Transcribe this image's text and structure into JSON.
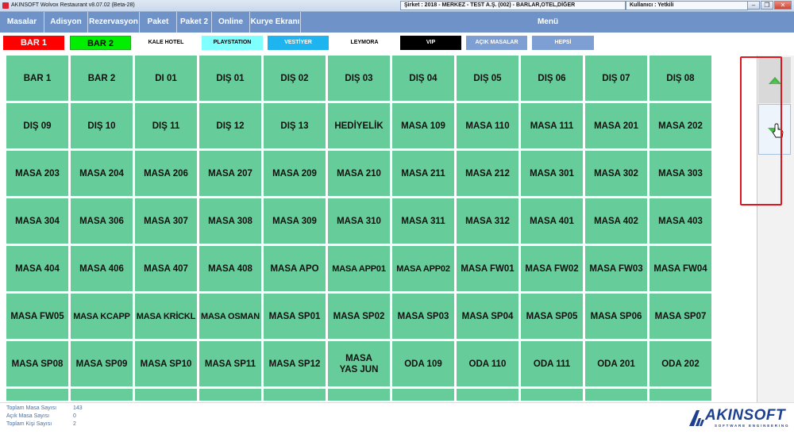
{
  "window": {
    "title": "AKINSOFT Wolvox Restaurant v8.07.02 (Beta-28)",
    "company": "Şirket : 2018 - MERKEZ - TEST A.Ş. (002) - BARLAR,OTEL,DİĞER",
    "user": "Kullanıcı : Yetkili",
    "buttons": {
      "minimize": "‒",
      "maximize": "▭",
      "restore": "❐",
      "close": "✕"
    }
  },
  "menu": {
    "items": [
      "Masalar",
      "Adisyon",
      "Rezervasyon",
      "Paket",
      "Paket 2",
      "Online",
      "Kurye Ekranı"
    ],
    "title": "Menü",
    "color": "#6f93c9"
  },
  "filters": [
    {
      "label": "BAR 1",
      "bg": "#ff0000",
      "fg": "#ffffff"
    },
    {
      "label": "BAR 2",
      "bg": "#00ee00",
      "fg": "#000000"
    },
    {
      "label": "KALE HOTEL",
      "bg": "#ffffff",
      "fg": "#000000"
    },
    {
      "label": "PLAYSTATION",
      "bg": "#80ffff",
      "fg": "#000000"
    },
    {
      "label": "VESTİYER",
      "bg": "#1eb4f0",
      "fg": "#ffffff"
    },
    {
      "label": "LEYMORA",
      "bg": "#ffffff",
      "fg": "#000000"
    },
    {
      "label": "VIP",
      "bg": "#000000",
      "fg": "#ffffff"
    },
    {
      "label": "AÇIK MASALAR",
      "bg": "#7d9fd4",
      "fg": "#ffffff"
    },
    {
      "label": "HEPSİ",
      "bg": "#7d9fd4",
      "fg": "#ffffff"
    }
  ],
  "tables": [
    "BAR 1",
    "BAR 2",
    "DI 01",
    "DIŞ 01",
    "DIŞ 02",
    "DIŞ 03",
    "DIŞ 04",
    "DIŞ 05",
    "DIŞ 06",
    "DIŞ 07",
    "DIŞ 08",
    "DIŞ 09",
    "DIŞ 10",
    "DIŞ 11",
    "DIŞ 12",
    "DIŞ 13",
    "HEDİYELİK",
    "MASA 109",
    "MASA 110",
    "MASA 111",
    "MASA 201",
    "MASA 202",
    "MASA 203",
    "MASA 204",
    "MASA 206",
    "MASA 207",
    "MASA 209",
    "MASA 210",
    "MASA 211",
    "MASA 212",
    "MASA 301",
    "MASA 302",
    "MASA 303",
    "MASA 304",
    "MASA 306",
    "MASA 307",
    "MASA 308",
    "MASA 309",
    "MASA 310",
    "MASA 311",
    "MASA 312",
    "MASA 401",
    "MASA 402",
    "MASA 403",
    "MASA 404",
    "MASA 406",
    "MASA 407",
    "MASA 408",
    "MASA APO",
    "MASA APP01",
    "MASA APP02",
    "MASA FW01",
    "MASA FW02",
    "MASA FW03",
    "MASA FW04",
    "MASA FW05",
    "MASA KCAPP",
    "MASA KRİCKL",
    "MASA OSMAN",
    "MASA SP01",
    "MASA SP02",
    "MASA SP03",
    "MASA SP04",
    "MASA SP05",
    "MASA SP06",
    "MASA SP07",
    "MASA SP08",
    "MASA SP09",
    "MASA SP10",
    "MASA SP11",
    "MASA SP12",
    "MASA YAS JUN",
    "ODA 109",
    "ODA 110",
    "ODA 111",
    "ODA 201",
    "ODA 202",
    "",
    "",
    "",
    "",
    "",
    "",
    "",
    "",
    "",
    "",
    ""
  ],
  "table_color": "#66cc99",
  "scroll": {
    "up_icon": "arrow-up-icon",
    "down_icon": "arrow-down-icon"
  },
  "stats": [
    {
      "label": "Toplam Masa Sayısı",
      "value": "143"
    },
    {
      "label": "Açık Masa Sayısı",
      "value": "0"
    },
    {
      "label": "Toplam Kişi Sayısı",
      "value": "2"
    }
  ],
  "logo": {
    "name": "AKINSOFT",
    "tagline": "SOFTWARE ENGINEERING"
  }
}
